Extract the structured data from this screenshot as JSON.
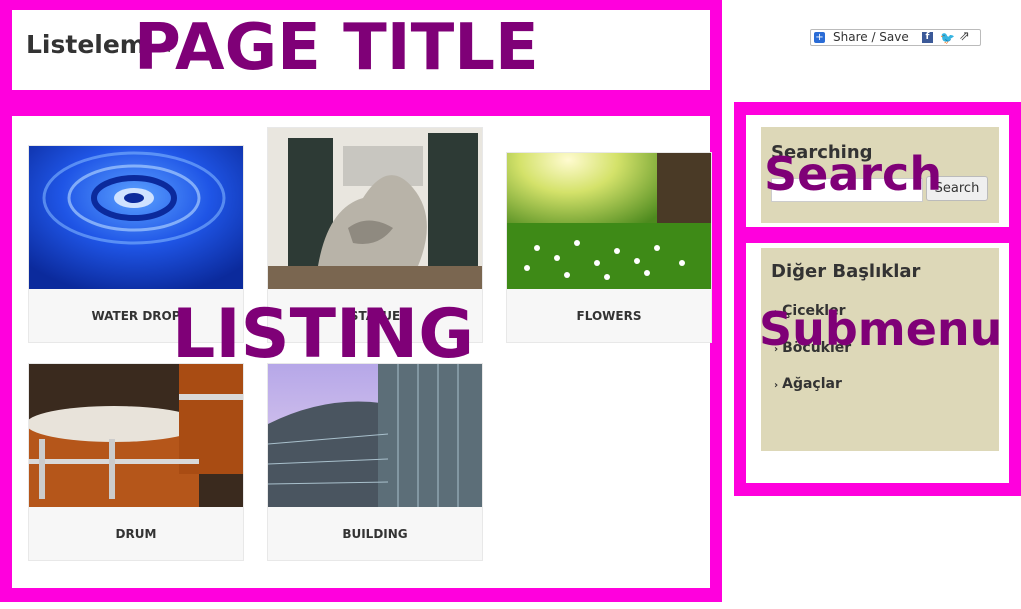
{
  "page": {
    "title": "Listelem",
    "edit_icon": "pencil-icon"
  },
  "annotations": {
    "page_title": "PAGE TITLE",
    "listing": "LISTING",
    "search": "Search",
    "submenu": "Submenu",
    "frame_color": "#ff00dd",
    "label_color": "#7f0077"
  },
  "share": {
    "label": "Share / Save",
    "icons": [
      "plus-icon",
      "facebook-icon",
      "twitter-icon",
      "share-arrow-icon"
    ]
  },
  "listing": {
    "items": [
      {
        "caption": "WATER DROP"
      },
      {
        "caption": "STATUE"
      },
      {
        "caption": "FLOWERS"
      },
      {
        "caption": "DRUM"
      },
      {
        "caption": "BUILDING"
      }
    ]
  },
  "search": {
    "title": "Searching",
    "input_value": "",
    "button_label": "Search"
  },
  "submenu": {
    "title": "Diğer Başlıklar",
    "items": [
      {
        "label": "Çicekler"
      },
      {
        "label": "Böcükler"
      },
      {
        "label": "Ağaçlar"
      }
    ]
  }
}
